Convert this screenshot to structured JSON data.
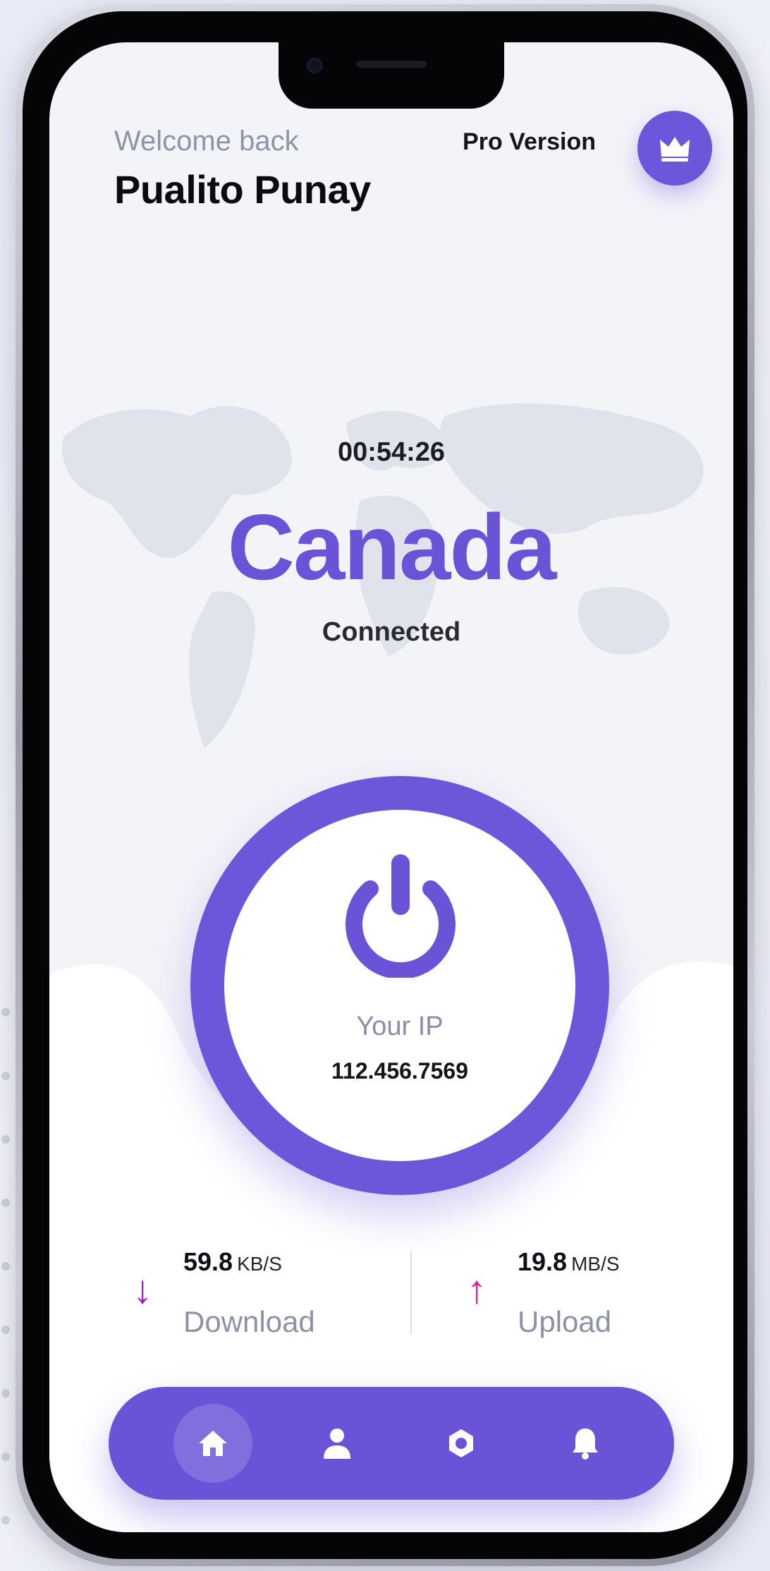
{
  "header": {
    "greeting": "Welcome back",
    "user_name": "Pualito Punay",
    "pro_label": "Pro Version",
    "pro_icon": "crown-icon"
  },
  "connection": {
    "timer": "00:54:26",
    "country": "Canada",
    "status": "Connected",
    "ip_label": "Your IP",
    "ip_value": "112.456.7569",
    "power_icon": "power-icon"
  },
  "stats": {
    "download": {
      "value": "59.8",
      "unit": "KB/S",
      "label": "Download",
      "icon": "arrow-down-icon"
    },
    "upload": {
      "value": "19.8",
      "unit": "MB/S",
      "label": "Upload",
      "icon": "arrow-up-icon"
    }
  },
  "nav": {
    "items": [
      {
        "icon": "home-icon",
        "active": true
      },
      {
        "icon": "user-icon",
        "active": false
      },
      {
        "icon": "settings-icon",
        "active": false
      },
      {
        "icon": "bell-icon",
        "active": false
      }
    ]
  },
  "colors": {
    "accent": "#6a53d6",
    "download_arrow": "#a020c8",
    "upload_arrow": "#e0208e"
  }
}
